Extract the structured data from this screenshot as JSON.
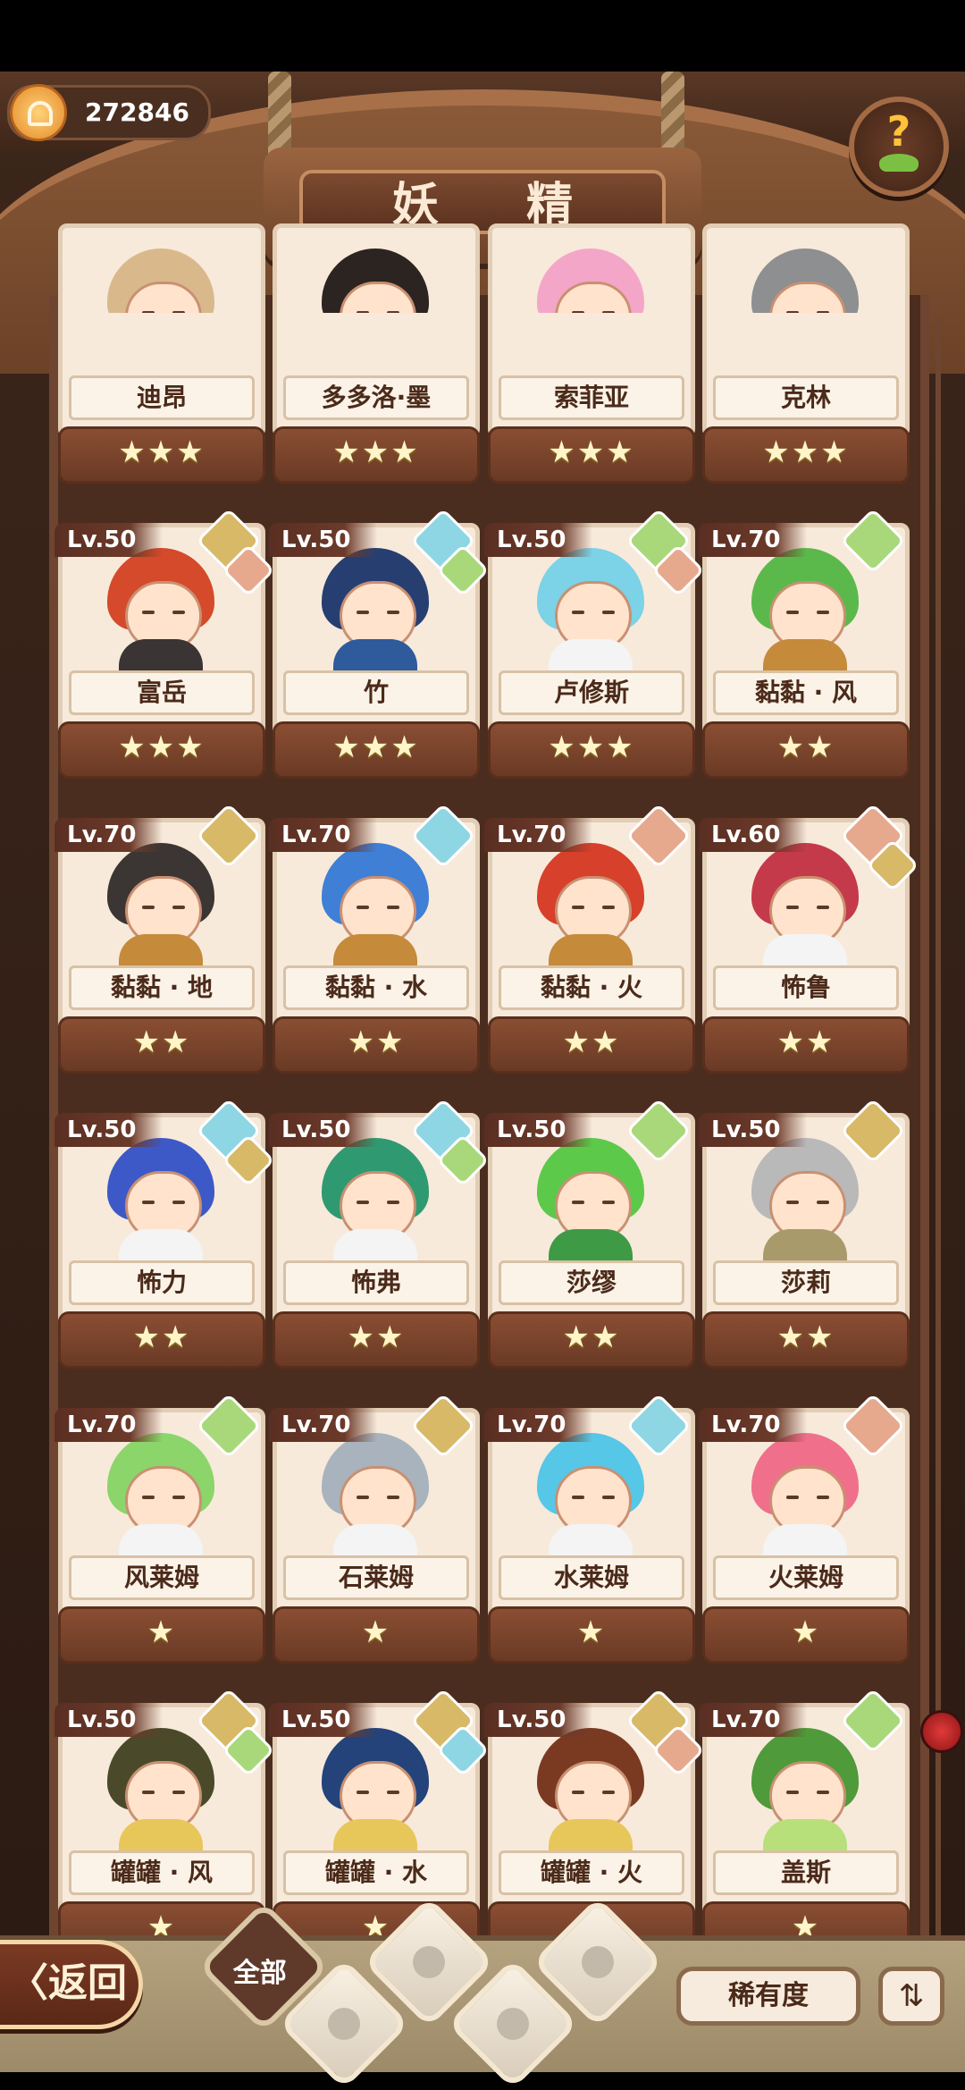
{
  "header": {
    "title": "妖 精",
    "coins": "272846",
    "help_label": "?"
  },
  "cards": [
    {
      "name": "迪昂",
      "stars": "★★★",
      "level": "",
      "hair": "#d9b98c",
      "body": "#e8c290",
      "elements": []
    },
    {
      "name": "多多洛·墨",
      "stars": "★★★",
      "level": "",
      "hair": "#2c2420",
      "body": "#a36b3c",
      "elements": []
    },
    {
      "name": "索菲亚",
      "stars": "★★★",
      "level": "",
      "hair": "#f4a6c8",
      "body": "#a9e0ee",
      "elements": []
    },
    {
      "name": "克林",
      "stars": "★★★",
      "level": "",
      "hair": "#8d8f91",
      "body": "#6f7275",
      "elements": []
    },
    {
      "name": "富岳",
      "stars": "★★★",
      "level": "Lv.50",
      "hair": "#d44a2a",
      "body": "#3a3434",
      "elements": [
        "earth",
        "fire"
      ]
    },
    {
      "name": "竹",
      "stars": "★★★",
      "level": "Lv.50",
      "hair": "#273e70",
      "body": "#2f5a9c",
      "elements": [
        "water",
        "wood"
      ]
    },
    {
      "name": "卢修斯",
      "stars": "★★★",
      "level": "Lv.50",
      "hair": "#7cd2e6",
      "body": "#f4f4f4",
      "elements": [
        "wood",
        "fire"
      ]
    },
    {
      "name": "黏黏 · 风",
      "stars": "★★",
      "level": "Lv.70",
      "hair": "#5bb94c",
      "body": "#c58a3a",
      "elements": [
        "wood"
      ]
    },
    {
      "name": "黏黏 · 地",
      "stars": "★★",
      "level": "Lv.70",
      "hair": "#3b3533",
      "body": "#c58a3a",
      "elements": [
        "earth"
      ]
    },
    {
      "name": "黏黏 · 水",
      "stars": "★★",
      "level": "Lv.70",
      "hair": "#3f7fd6",
      "body": "#c58a3a",
      "elements": [
        "water"
      ]
    },
    {
      "name": "黏黏 · 火",
      "stars": "★★",
      "level": "Lv.70",
      "hair": "#d7402a",
      "body": "#c58a3a",
      "elements": [
        "fire"
      ]
    },
    {
      "name": "怖鲁",
      "stars": "★★",
      "level": "Lv.60",
      "hair": "#c43a4a",
      "body": "#f4f4f4",
      "elements": [
        "fire",
        "earth"
      ]
    },
    {
      "name": "怖力",
      "stars": "★★",
      "level": "Lv.50",
      "hair": "#3d59c7",
      "body": "#f4f4f4",
      "elements": [
        "water",
        "earth"
      ]
    },
    {
      "name": "怖弗",
      "stars": "★★",
      "level": "Lv.50",
      "hair": "#2f9a72",
      "body": "#f4f4f4",
      "elements": [
        "water",
        "wood"
      ]
    },
    {
      "name": "莎缪",
      "stars": "★★",
      "level": "Lv.50",
      "hair": "#5cc94a",
      "body": "#3f9a45",
      "elements": [
        "wood"
      ]
    },
    {
      "name": "莎莉",
      "stars": "★★",
      "level": "Lv.50",
      "hair": "#b9b9b9",
      "body": "#a89a6a",
      "elements": [
        "earth"
      ]
    },
    {
      "name": "风莱姆",
      "stars": "★",
      "level": "Lv.70",
      "hair": "#8bd56a",
      "body": "#f4f4f4",
      "elements": [
        "wood"
      ]
    },
    {
      "name": "石莱姆",
      "stars": "★",
      "level": "Lv.70",
      "hair": "#a9b3bd",
      "body": "#f4f4f4",
      "elements": [
        "earth"
      ]
    },
    {
      "name": "水莱姆",
      "stars": "★",
      "level": "Lv.70",
      "hair": "#56c7e6",
      "body": "#f4f4f4",
      "elements": [
        "water"
      ]
    },
    {
      "name": "火莱姆",
      "stars": "★",
      "level": "Lv.70",
      "hair": "#f0708c",
      "body": "#f4f4f4",
      "elements": [
        "fire"
      ]
    },
    {
      "name": "罐罐 · 风",
      "stars": "★",
      "level": "Lv.50",
      "hair": "#4a4a2a",
      "body": "#e8c75a",
      "elements": [
        "earth",
        "wood"
      ]
    },
    {
      "name": "罐罐 · 水",
      "stars": "★",
      "level": "Lv.50",
      "hair": "#23437a",
      "body": "#e8c75a",
      "elements": [
        "earth",
        "water"
      ]
    },
    {
      "name": "罐罐 · 火",
      "stars": "★",
      "level": "Lv.50",
      "hair": "#7a3a22",
      "body": "#e8c75a",
      "elements": [
        "earth",
        "fire"
      ]
    },
    {
      "name": "盖斯",
      "stars": "★",
      "level": "Lv.70",
      "hair": "#4f9a3a",
      "body": "#b8e07a",
      "elements": [
        "wood"
      ]
    }
  ],
  "bottom": {
    "back_label": "〈返回",
    "filter_all": "全部",
    "rarity_label": "稀有度",
    "sort_label": "⇅"
  }
}
